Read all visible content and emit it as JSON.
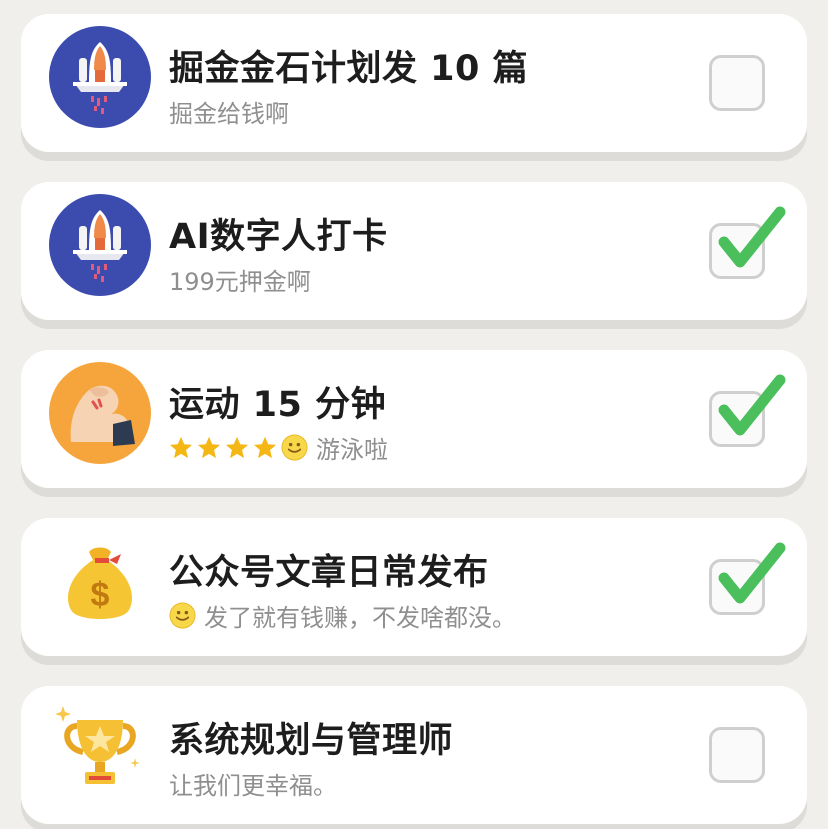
{
  "tasks": [
    {
      "title": "掘金金石计划发 10 篇",
      "subtitle": "掘金给钱啊",
      "icon": "rocket-icon",
      "checked": false
    },
    {
      "title": "AI数字人打卡",
      "subtitle": "199元押金啊",
      "icon": "rocket-icon",
      "checked": true
    },
    {
      "title": "运动 15 分钟",
      "subtitle": "游泳啦",
      "icon": "muscle-arm-icon",
      "checked": true,
      "rating": 4
    },
    {
      "title": "公众号文章日常发布",
      "subtitle": "发了就有钱赚，不发啥都没。",
      "icon": "money-bag-icon",
      "checked": true
    },
    {
      "title": "系统规划与管理师",
      "subtitle": "让我们更幸福。",
      "icon": "trophy-icon",
      "checked": false
    }
  ],
  "colors": {
    "check": "#4bbf5c",
    "rocket_bg": "#3b4cae",
    "muscle_bg": "#f6a53c",
    "star": "#f5b716"
  }
}
